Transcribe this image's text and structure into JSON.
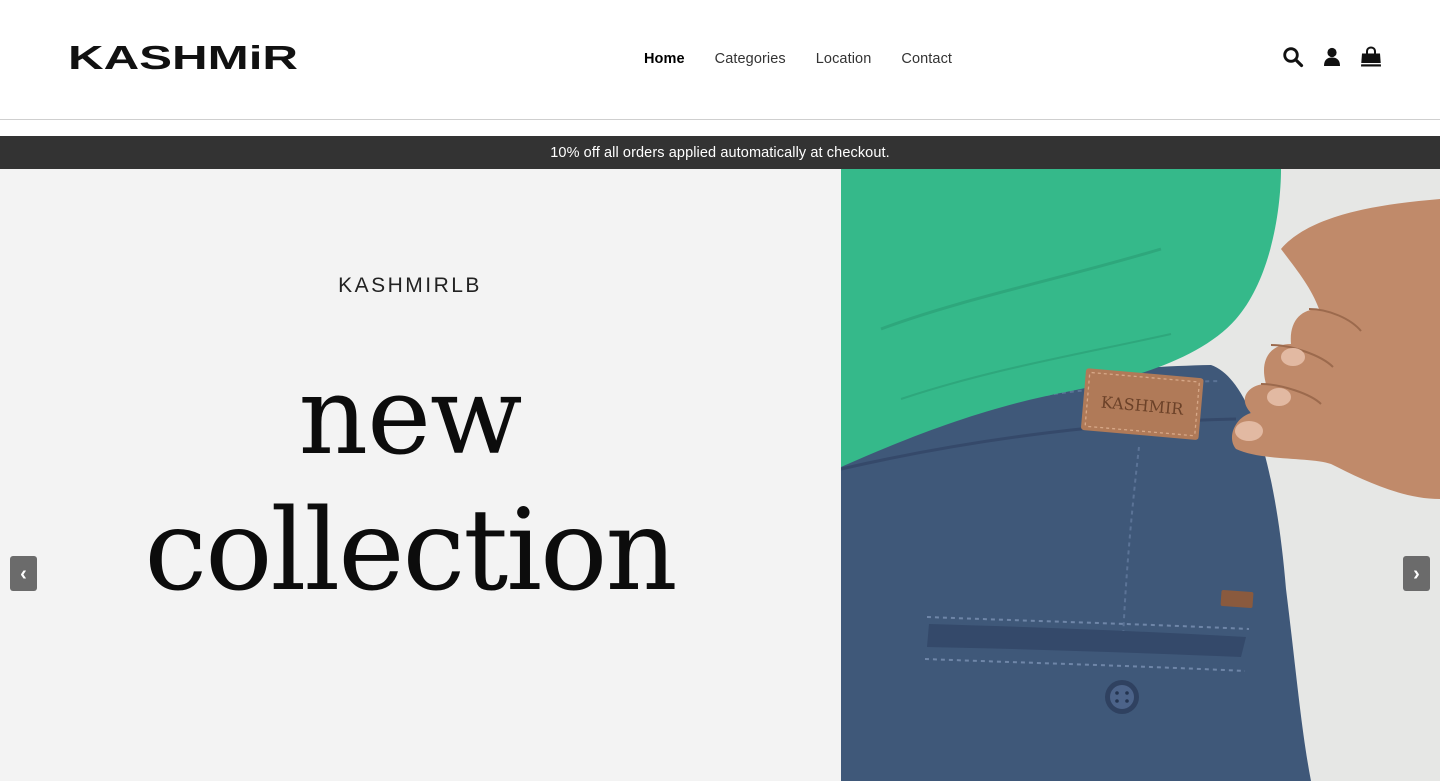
{
  "header": {
    "logo_text": "KASHMiR",
    "nav": [
      {
        "label": "Home",
        "active": true
      },
      {
        "label": "Categories",
        "active": false
      },
      {
        "label": "Location",
        "active": false
      },
      {
        "label": "Contact",
        "active": false
      }
    ],
    "icons": [
      "search-icon",
      "account-icon",
      "cart-icon"
    ]
  },
  "announcement": {
    "text": "10% off all orders applied automatically at checkout."
  },
  "hero": {
    "brand": "KASHMIRLB",
    "headline_line1": "new",
    "headline_line2": "collection",
    "label_patch_text": "KASHMIR",
    "prev_arrow": "‹",
    "next_arrow": "›"
  },
  "colors": {
    "announcement_bg": "#333333",
    "hero_left_bg": "#f3f3f3",
    "shirt_green": "#35b98a",
    "pants_navy": "#3f5879",
    "arrow_bg": "#6b6b6b"
  }
}
